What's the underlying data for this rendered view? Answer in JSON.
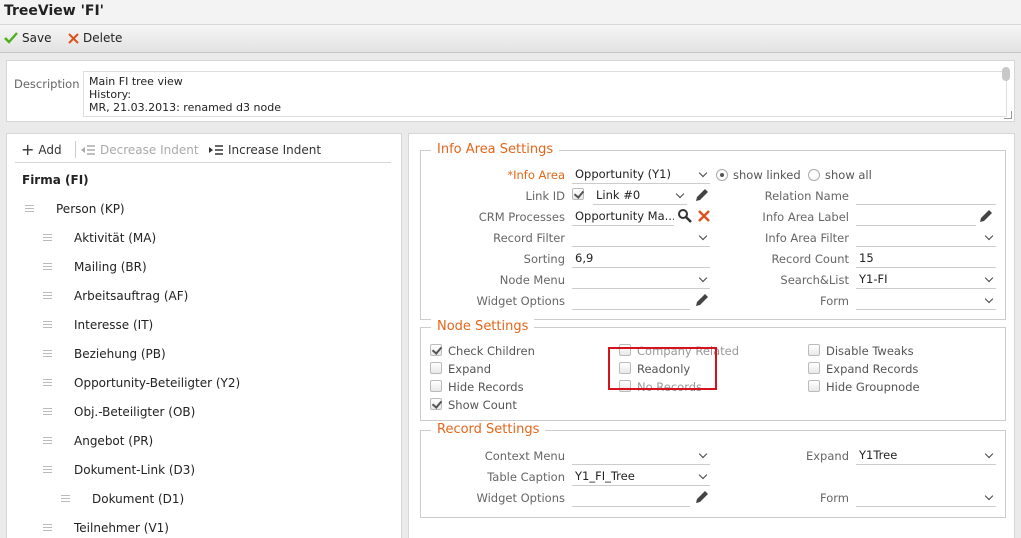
{
  "window": {
    "title": "TreeView 'FI'"
  },
  "toolbar": {
    "save_label": "Save",
    "delete_label": "Delete"
  },
  "description": {
    "label": "Description",
    "text": "Main FI tree view\nHistory:\nMR, 21.03.2013: renamed d3 node"
  },
  "tree_toolbar": {
    "add_label": "Add",
    "decrease_label": "Decrease Indent",
    "increase_label": "Increase Indent"
  },
  "tree": {
    "root": "Firma (FI)",
    "items": [
      {
        "label": "Person (KP)",
        "level": 1
      },
      {
        "label": "Aktivität (MA)",
        "level": 2
      },
      {
        "label": "Mailing (BR)",
        "level": 2
      },
      {
        "label": "Arbeitsauftrag (AF)",
        "level": 2
      },
      {
        "label": "Interesse (IT)",
        "level": 2
      },
      {
        "label": "Beziehung (PB)",
        "level": 2
      },
      {
        "label": "Opportunity-Beteiligter (Y2)",
        "level": 2
      },
      {
        "label": "Obj.-Beteiligter (OB)",
        "level": 2
      },
      {
        "label": "Angebot (PR)",
        "level": 2
      },
      {
        "label": "Dokument-Link (D3)",
        "level": 2
      },
      {
        "label": "Dokument (D1)",
        "level": 3
      },
      {
        "label": "Teilnehmer (V1)",
        "level": 2
      }
    ]
  },
  "info_area": {
    "legend": "Info Area Settings",
    "info_area_label": "*Info Area",
    "info_area_value": "Opportunity (Y1)",
    "show_linked": "show linked",
    "show_all": "show all",
    "link_id_label": "Link ID",
    "link_id_value": "Link #0",
    "relation_name_label": "Relation Name",
    "crm_processes_label": "CRM Processes",
    "crm_processes_value": "Opportunity Ma...",
    "info_area_label_label": "Info Area Label",
    "record_filter_label": "Record Filter",
    "info_area_filter_label": "Info Area Filter",
    "sorting_label": "Sorting",
    "sorting_value": "6,9",
    "record_count_label": "Record Count",
    "record_count_value": "15",
    "node_menu_label": "Node Menu",
    "search_list_label": "Search&List",
    "search_list_value": "Y1-FI",
    "widget_options_label": "Widget Options",
    "form_label": "Form"
  },
  "node_settings": {
    "legend": "Node Settings",
    "check_children": "Check Children",
    "expand": "Expand",
    "hide_records": "Hide Records",
    "show_count": "Show Count",
    "company_related": "Company Related",
    "readonly": "Readonly",
    "no_records": "No Records",
    "disable_tweaks": "Disable Tweaks",
    "expand_records": "Expand Records",
    "hide_groupnode": "Hide Groupnode"
  },
  "record_settings": {
    "legend": "Record Settings",
    "context_menu_label": "Context Menu",
    "table_caption_label": "Table  Caption",
    "table_caption_value": "Y1_FI_Tree",
    "widget_options_label": "Widget Options",
    "expand_label": "Expand",
    "expand_value": "Y1Tree",
    "form_label": "Form"
  },
  "colors": {
    "accent": "#e3661a",
    "highlight": "#d4141c",
    "save_check": "#4caf1e",
    "delete_x": "#d9531e"
  }
}
